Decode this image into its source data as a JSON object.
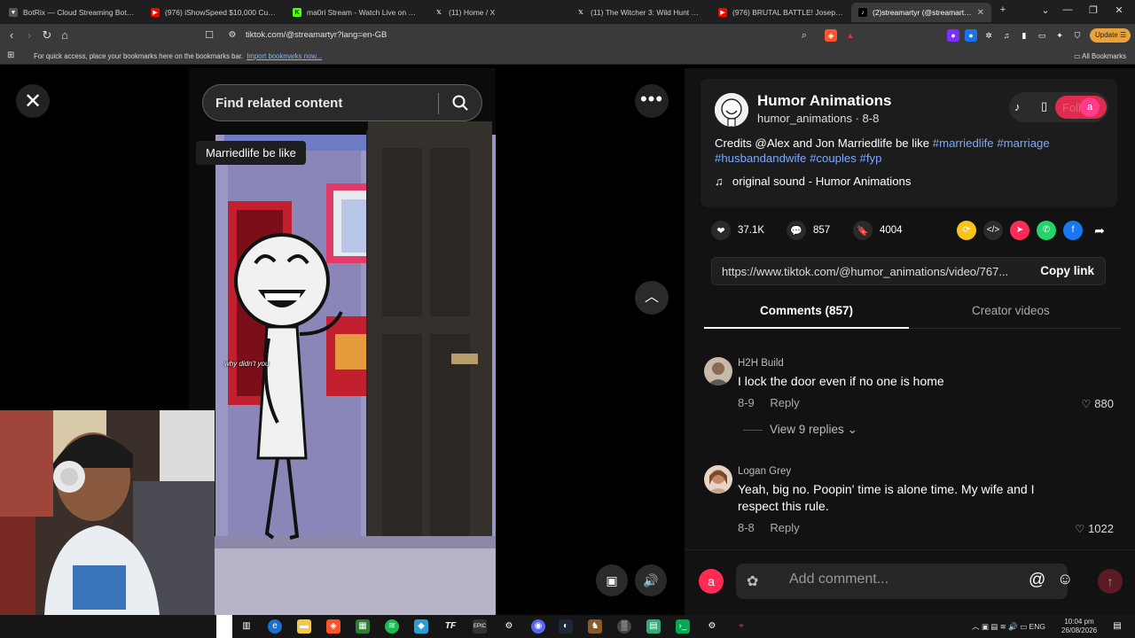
{
  "browser": {
    "tabs": [
      {
        "title": "BotRix — Cloud Streaming Bot for Twitch",
        "icon": "botrix-icon",
        "color": "#8a8a8a"
      },
      {
        "title": "(976) iShowSpeed $10,000 Cube Challenge",
        "icon": "youtube-icon",
        "color": "#ff0000"
      },
      {
        "title": "ma0ri Stream - Watch Live on Kick",
        "icon": "kick-icon",
        "color": "#53fc18"
      },
      {
        "title": "(11) Home / X",
        "icon": "x-icon",
        "color": "#000000"
      },
      {
        "title": "(11) The Witcher 3: Wild Hunt Remastered",
        "icon": "x-icon",
        "color": "#000000"
      },
      {
        "title": "(976) BRUTAL BATTLE! Joseph Parker",
        "icon": "youtube-icon",
        "color": "#ff0000"
      },
      {
        "title": "(2)streamartyr (@streamartyr)",
        "icon": "tiktok-icon",
        "color": "#000000"
      }
    ],
    "url": "tiktok.com/@streamartyr?lang=en-GB",
    "update_label": "Update",
    "bookmarks_hint": "For quick access, place your bookmarks here on the bookmarks bar.",
    "bookmarks_link": "Import bookmarks now...",
    "all_bookmarks": "All Bookmarks"
  },
  "video": {
    "search_placeholder": "Find related content",
    "caption_badge": "Marriedlife be like",
    "subtitle": "why didn't you"
  },
  "creator": {
    "name": "Humor Animations",
    "handle": "humor_animations",
    "date": "8-8",
    "follow_label": "Follow",
    "avatar_letter": "a"
  },
  "description": {
    "text": "Credits @Alex and Jon Marriedlife be like",
    "hashtags": [
      "#marriedlife",
      "#marriage",
      "#husbandandwife",
      "#couples",
      "#fyp"
    ]
  },
  "sound": "original sound - Humor Animations",
  "stats": {
    "likes": "37.1K",
    "comments": "857",
    "saves": "4004"
  },
  "share_icons": [
    {
      "name": "repost-icon",
      "color": "#f5c518"
    },
    {
      "name": "embed-icon",
      "color": "#2b2b2b"
    },
    {
      "name": "send-to-friends-icon",
      "color": "#fe2c55"
    },
    {
      "name": "whatsapp-icon",
      "color": "#25d366"
    },
    {
      "name": "facebook-icon",
      "color": "#1877f2"
    },
    {
      "name": "share-arrow-icon",
      "color": "#121212"
    }
  ],
  "link": {
    "url": "https://www.tiktok.com/@humor_animations/video/767...",
    "copy_label": "Copy link"
  },
  "tabs": {
    "comments": "Comments (857)",
    "creator_videos": "Creator videos"
  },
  "comments": [
    {
      "user": "H2H Build",
      "text": "I lock the door even if no one is home",
      "date": "8-9",
      "reply": "Reply",
      "likes": "880",
      "view_replies": "View 9 replies"
    },
    {
      "user": "Logan Grey",
      "text": "Yeah, big no. Poopin' time is alone time. My wife and I respect this rule.",
      "date": "8-8",
      "reply": "Reply",
      "likes": "1022"
    }
  ],
  "composer": {
    "avatar_letter": "a",
    "placeholder": "Add comment..."
  },
  "taskbar": {
    "language": "ENG",
    "time": "10:04 pm",
    "date": "26/08/2026"
  },
  "colors": {
    "accent": "#fe2c55",
    "hashtag": "#7aa9ff",
    "panel_bg": "#121212"
  }
}
